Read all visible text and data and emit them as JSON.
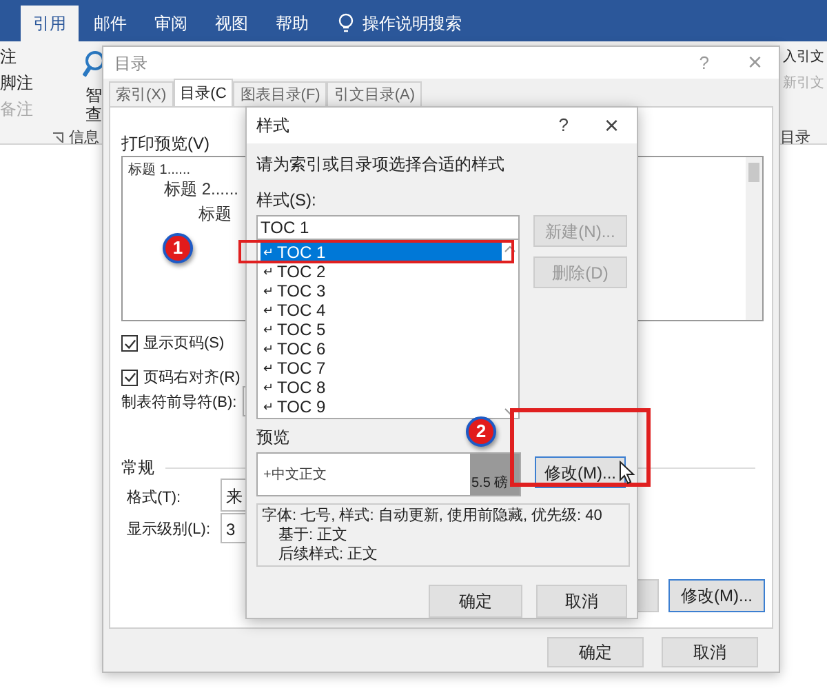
{
  "ribbon": {
    "tabs": [
      {
        "label": "引用",
        "selected": true
      },
      {
        "label": "邮件",
        "selected": false
      },
      {
        "label": "审阅",
        "selected": false
      },
      {
        "label": "视图",
        "selected": false
      },
      {
        "label": "帮助",
        "selected": false
      }
    ],
    "search": "操作说明搜索",
    "left_items": [
      {
        "label": "注",
        "disabled": false
      },
      {
        "label": "脚注",
        "disabled": false
      },
      {
        "label": "备注",
        "disabled": true
      }
    ],
    "smart_lookup": [
      "智",
      "查"
    ],
    "group_label_left": "信息",
    "right_items": [
      {
        "label": "入引文",
        "disabled": false
      },
      {
        "label": "新引文",
        "disabled": true
      }
    ],
    "group_label_right": "目录"
  },
  "toc_dialog": {
    "title": "目录",
    "help": "?",
    "close": "×",
    "tabs": [
      {
        "label": "索引(X)",
        "selected": false
      },
      {
        "label": "目录(C",
        "selected": true
      },
      {
        "label": "图表目录(F)",
        "selected": false
      },
      {
        "label": "引文目录(A)",
        "selected": false
      }
    ],
    "preview_label": "打印预览(V)",
    "preview_lines": [
      {
        "text": "标题 1......",
        "kind": "h1"
      },
      {
        "text": "标题 2......",
        "kind": "h2"
      },
      {
        "text": "标题",
        "kind": "h3"
      }
    ],
    "show_page_numbers": {
      "label": "显示页码(S)",
      "checked": true
    },
    "right_align": {
      "label": "页码右对齐(R)",
      "checked": true
    },
    "leader_label": "制表符前导符(B):",
    "general_label": "常规",
    "format_label": "格式(T):",
    "format_value": "来",
    "levels_label": "显示级别(L):",
    "levels_value": "3",
    "modify_button": "修改(M)...",
    "ok": "确定",
    "cancel": "取消"
  },
  "style_dialog": {
    "title": "样式",
    "help": "?",
    "close": "×",
    "instruction": "请为索引或目录项选择合适的样式",
    "styles_label": "样式(S):",
    "style_input": "TOC 1",
    "styles": [
      {
        "label": "TOC 1",
        "selected": true
      },
      {
        "label": "TOC 2",
        "selected": false
      },
      {
        "label": "TOC 3",
        "selected": false
      },
      {
        "label": "TOC 4",
        "selected": false
      },
      {
        "label": "TOC 5",
        "selected": false
      },
      {
        "label": "TOC 6",
        "selected": false
      },
      {
        "label": "TOC 7",
        "selected": false
      },
      {
        "label": "TOC 8",
        "selected": false
      },
      {
        "label": "TOC 9",
        "selected": false
      }
    ],
    "paragraph_mark": "↵",
    "new_button": {
      "label": "新建(N)...",
      "disabled": true
    },
    "delete_button": {
      "label": "删除(D)",
      "disabled": true
    },
    "preview_label": "预览",
    "preview_text": "+中文正文",
    "preview_size": "5.5 磅",
    "modify_button": "修改(M)...",
    "description": [
      "字体: 七号, 样式: 自动更新, 使用前隐藏, 优先级: 40",
      "基于: 正文",
      "后续样式: 正文"
    ],
    "ok": "确定",
    "cancel": "取消"
  },
  "annotations": [
    {
      "label": "1"
    },
    {
      "label": "2"
    }
  ]
}
